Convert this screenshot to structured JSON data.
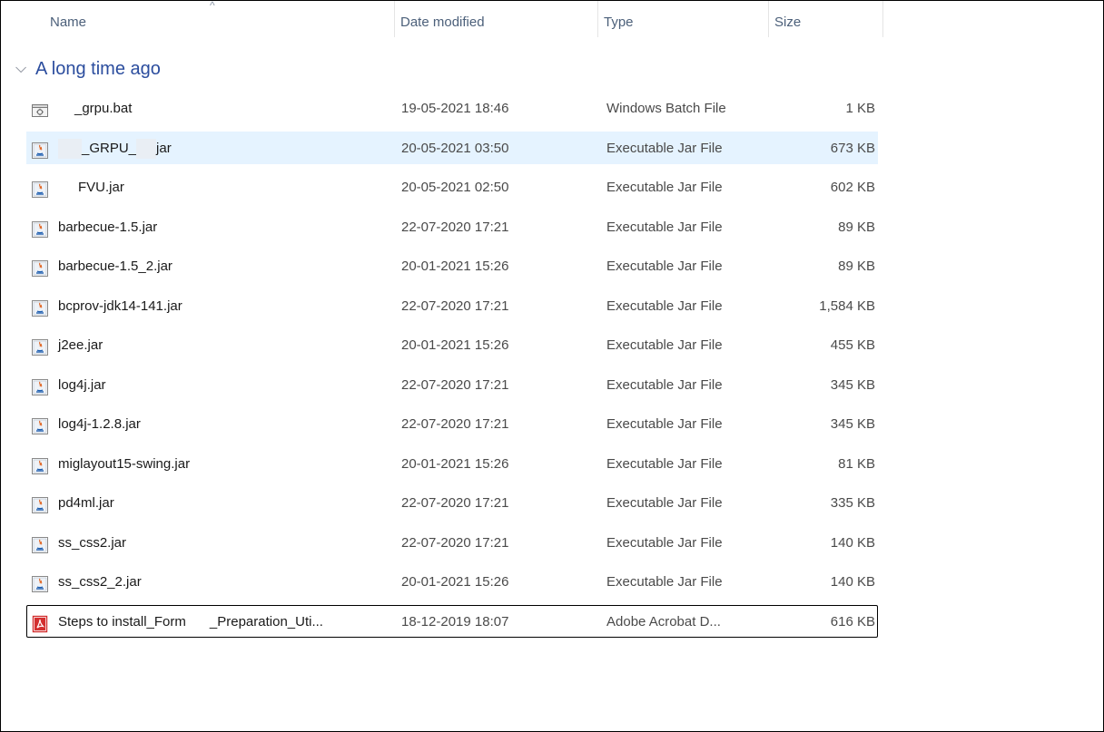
{
  "columns": {
    "name": "Name",
    "date": "Date modified",
    "type": "Type",
    "size": "Size"
  },
  "sort_indicator": "^",
  "group": {
    "chevron": "⌵",
    "title": "A long time ago"
  },
  "files": [
    {
      "name": "_grpu.bat",
      "date": "19-05-2021 18:46",
      "type": "Windows Batch File",
      "size": "1 KB",
      "icon": "batch-file-icon"
    },
    {
      "name_parts": [
        "_GRPU_",
        "jar"
      ],
      "date": "20-05-2021 03:50",
      "type": "Executable Jar File",
      "size": "673 KB",
      "icon": "jar-file-icon"
    },
    {
      "name": "FVU.jar",
      "date": "20-05-2021 02:50",
      "type": "Executable Jar File",
      "size": "602 KB",
      "icon": "jar-file-icon"
    },
    {
      "name": "barbecue-1.5.jar",
      "date": "22-07-2020 17:21",
      "type": "Executable Jar File",
      "size": "89 KB",
      "icon": "jar-file-icon"
    },
    {
      "name": "barbecue-1.5_2.jar",
      "date": "20-01-2021 15:26",
      "type": "Executable Jar File",
      "size": "89 KB",
      "icon": "jar-file-icon"
    },
    {
      "name": "bcprov-jdk14-141.jar",
      "date": "22-07-2020 17:21",
      "type": "Executable Jar File",
      "size": "1,584 KB",
      "icon": "jar-file-icon"
    },
    {
      "name": "j2ee.jar",
      "date": "20-01-2021 15:26",
      "type": "Executable Jar File",
      "size": "455 KB",
      "icon": "jar-file-icon"
    },
    {
      "name": "log4j.jar",
      "date": "22-07-2020 17:21",
      "type": "Executable Jar File",
      "size": "345 KB",
      "icon": "jar-file-icon"
    },
    {
      "name": "log4j-1.2.8.jar",
      "date": "22-07-2020 17:21",
      "type": "Executable Jar File",
      "size": "345 KB",
      "icon": "jar-file-icon"
    },
    {
      "name": "miglayout15-swing.jar",
      "date": "20-01-2021 15:26",
      "type": "Executable Jar File",
      "size": "81 KB",
      "icon": "jar-file-icon"
    },
    {
      "name": "pd4ml.jar",
      "date": "22-07-2020 17:21",
      "type": "Executable Jar File",
      "size": "335 KB",
      "icon": "jar-file-icon"
    },
    {
      "name": "ss_css2.jar",
      "date": "22-07-2020 17:21",
      "type": "Executable Jar File",
      "size": "140 KB",
      "icon": "jar-file-icon"
    },
    {
      "name": "ss_css2_2.jar",
      "date": "20-01-2021 15:26",
      "type": "Executable Jar File",
      "size": "140 KB",
      "icon": "jar-file-icon"
    },
    {
      "name_parts": [
        "Steps to install_Form",
        "_Preparation_Uti..."
      ],
      "date": "18-12-2019 18:07",
      "type": "Adobe Acrobat D...",
      "size": "616 KB",
      "icon": "pdf-file-icon"
    }
  ],
  "colors": {
    "header_text": "#4c607a",
    "group_title": "#2b4d9e",
    "hover_row": "#e5f3ff",
    "pdf_red": "#d32f2f"
  }
}
